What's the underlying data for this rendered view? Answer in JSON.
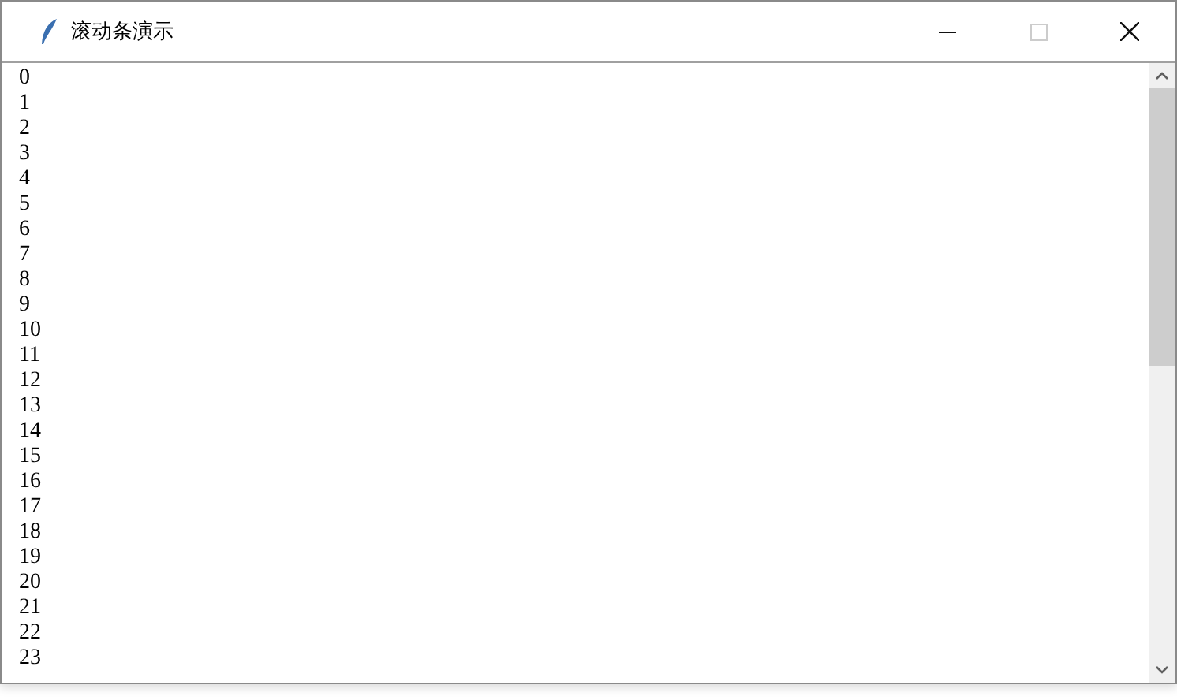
{
  "window": {
    "title": "滚动条演示",
    "controls": [
      {
        "kind": "minimize",
        "disabled": false
      },
      {
        "kind": "maximize",
        "disabled": true
      },
      {
        "kind": "close",
        "disabled": false
      }
    ]
  },
  "listbox": {
    "items": [
      "0",
      "1",
      "2",
      "3",
      "4",
      "5",
      "6",
      "7",
      "8",
      "9",
      "10",
      "11",
      "12",
      "13",
      "14",
      "15",
      "16",
      "17",
      "18",
      "19",
      "20",
      "21",
      "22",
      "23"
    ]
  }
}
